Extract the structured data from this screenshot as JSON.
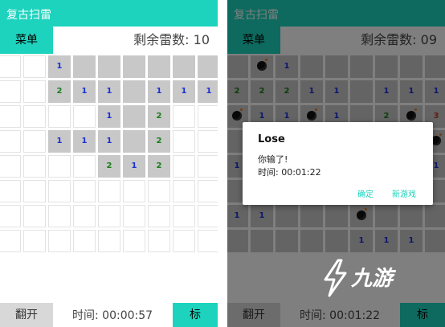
{
  "left": {
    "app_title": "复古扫雷",
    "menu_label": "菜单",
    "mines_label": "剩余雷数:",
    "mines_value": "10",
    "open_label": "翻开",
    "timer_label": "时间:",
    "timer_value": "00:00:57",
    "flag_label": "标",
    "rows": [
      [
        "",
        "",
        "1o",
        "o",
        "o",
        "o",
        "o",
        "o",
        "o"
      ],
      [
        "",
        "",
        "2o",
        "1o",
        "1o",
        "o",
        "1o",
        "1o",
        "1o"
      ],
      [
        "",
        "",
        "",
        "",
        "1o",
        "o",
        "2o",
        "",
        ""
      ],
      [
        "",
        "",
        "1o",
        "1o",
        "1o",
        "o",
        "2o",
        "",
        ""
      ],
      [
        "",
        "",
        "",
        "",
        "2o",
        "1o",
        "2o",
        "",
        ""
      ],
      [
        "",
        "",
        "",
        "",
        "",
        "",
        "",
        "",
        ""
      ],
      [
        "",
        "",
        "",
        "",
        "",
        "",
        "",
        "",
        ""
      ],
      [
        "",
        "",
        "",
        "",
        "",
        "",
        "",
        "",
        ""
      ]
    ]
  },
  "right": {
    "app_title": "复古扫雷",
    "menu_label": "菜单",
    "mines_label": "剩余雷数:",
    "mines_value": "09",
    "open_label": "翻开",
    "timer_label": "时间:",
    "timer_value": "00:01:22",
    "flag_label": "标",
    "rows": [
      [
        "o",
        "b",
        "1o",
        "o",
        "o",
        "o",
        "o",
        "o",
        "o"
      ],
      [
        "2o",
        "2o",
        "2o",
        "1o",
        "1o",
        "o",
        "1o",
        "1o",
        "1o"
      ],
      [
        "b",
        "1o",
        "1o",
        "b",
        "1o",
        "o",
        "2o",
        "b",
        "3o"
      ],
      [
        "o",
        "o",
        "o",
        "o",
        "o",
        "o",
        "o",
        "o",
        "b"
      ],
      [
        "1o",
        "o",
        "o",
        "o",
        "o",
        "o",
        "o",
        "o",
        "1o"
      ],
      [
        "o",
        "o",
        "o",
        "o",
        "o",
        "o",
        "o",
        "o",
        "o"
      ],
      [
        "1o",
        "1o",
        "o",
        "o",
        "o",
        "b",
        "o",
        "o",
        "o"
      ],
      [
        "o",
        "o",
        "o",
        "o",
        "o",
        "1o",
        "1o",
        "1o",
        "o"
      ]
    ],
    "dialog": {
      "title": "Lose",
      "message": "你输了!",
      "time_label": "时间:",
      "time_value": "00:01:22",
      "confirm_label": "确定",
      "new_game_label": "新游戏"
    }
  },
  "watermark": {
    "text": "九游"
  },
  "colors": {
    "accent": "#1dd3bd",
    "opened": "#c8c8c8",
    "num1": "#1a2fd6",
    "num2": "#1b7d1b",
    "num3": "#c0392b"
  },
  "icons": {
    "mine": "bomb-icon"
  }
}
